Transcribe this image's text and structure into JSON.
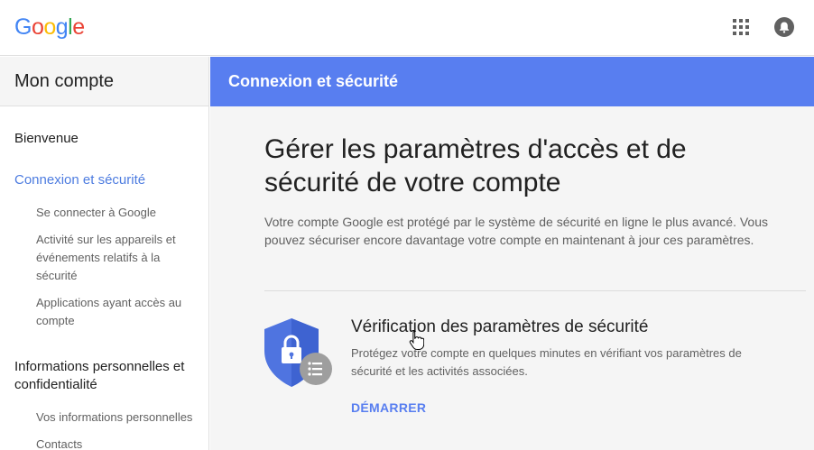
{
  "header": {
    "logo_letters": [
      {
        "ch": "G",
        "color": "#4285F4"
      },
      {
        "ch": "o",
        "color": "#EA4335"
      },
      {
        "ch": "o",
        "color": "#FBBC05"
      },
      {
        "ch": "g",
        "color": "#4285F4"
      },
      {
        "ch": "l",
        "color": "#34A853"
      },
      {
        "ch": "e",
        "color": "#EA4335"
      }
    ],
    "apps_icon": "apps-grid-icon",
    "account_icon": "notification-bell-icon"
  },
  "sidebar": {
    "title": "Mon compte",
    "sections": [
      {
        "label": "Bienvenue",
        "active": false
      },
      {
        "label": "Connexion et sécurité",
        "active": true,
        "items": [
          "Se connecter à Google",
          "Activité sur les appareils et événements relatifs à la sécurité",
          "Applications ayant accès au compte"
        ]
      },
      {
        "label": "Informations personnelles et confidentialité",
        "active": false,
        "items": [
          "Vos informations personnelles",
          "Contacts"
        ]
      }
    ]
  },
  "main": {
    "header_title": "Connexion et sécurité",
    "page_title": "Gérer les paramètres d'accès et de sécurité de votre compte",
    "intro": "Votre compte Google est protégé par le système de sécurité en ligne le plus avancé. Vous pouvez sécuriser encore davantage votre compte en maintenant à jour ces paramètres.",
    "card": {
      "title": "Vérification des paramètres de sécurité",
      "description": "Protégez votre compte en quelques minutes en vérifiant vos paramètres de sécurité et les activités associées.",
      "action_label": "DÉMARRER",
      "icon": "security-shield-lock-icon"
    }
  },
  "colors": {
    "accent": "#587ef0",
    "active_nav": "#4d7ce0",
    "shield": "#4f74e0"
  }
}
